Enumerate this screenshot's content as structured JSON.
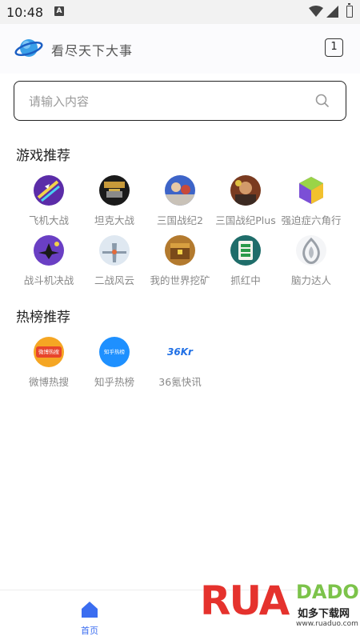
{
  "status_bar": {
    "time": "10:48",
    "notification_letter": "A"
  },
  "header": {
    "title": "看尽天下大事",
    "tab_count": "1"
  },
  "search": {
    "placeholder": "请输入内容",
    "value": ""
  },
  "games_section": {
    "title": "游戏推荐",
    "items": [
      {
        "label": "飞机大战",
        "icon": "plane-battle-game-icon",
        "color": "#5b2ca8"
      },
      {
        "label": "坦克大战",
        "icon": "tank-battle-game-icon",
        "color": "#1a1a1a"
      },
      {
        "label": "三国战纪2",
        "icon": "three-kingdoms-2-game-icon",
        "color": "#3d64c8"
      },
      {
        "label": "三国战纪Plus",
        "icon": "three-kingdoms-plus-game-icon",
        "color": "#7a3b20"
      },
      {
        "label": "强迫症六角行",
        "icon": "hexagon-game-icon",
        "color": "#7b4fd6"
      },
      {
        "label": "战斗机决战",
        "icon": "fighter-jet-game-icon",
        "color": "#6a3fc4"
      },
      {
        "label": "二战风云",
        "icon": "ww2-game-icon",
        "color": "#9fb6cf"
      },
      {
        "label": "我的世界挖矿",
        "icon": "minecraft-mining-game-icon",
        "color": "#b37a2e"
      },
      {
        "label": "抓红中",
        "icon": "mahjong-game-icon",
        "color": "#1f6d6a"
      },
      {
        "label": "脑力达人",
        "icon": "brain-master-game-icon",
        "color": "#cfd3d8"
      }
    ]
  },
  "hot_section": {
    "title": "热榜推荐",
    "items": [
      {
        "label": "微博热搜",
        "icon": "weibo-hot-icon",
        "badge": "微博热搜",
        "color": "#f5a623"
      },
      {
        "label": "知乎热榜",
        "icon": "zhihu-hot-icon",
        "badge": "知乎热榜",
        "color": "#1e90ff"
      },
      {
        "label": "36氪快讯",
        "icon": "36kr-news-icon",
        "badge": "36Kr",
        "color": "#1f6fe5"
      }
    ]
  },
  "bottom_nav": {
    "home_label": "首页",
    "accent": "#3b6df0"
  },
  "watermark": {
    "letters_1": "RU",
    "letters_2": "A",
    "letters_3": "DADO",
    "cn": "如多下载网",
    "url": "www.ruaduo.com"
  }
}
